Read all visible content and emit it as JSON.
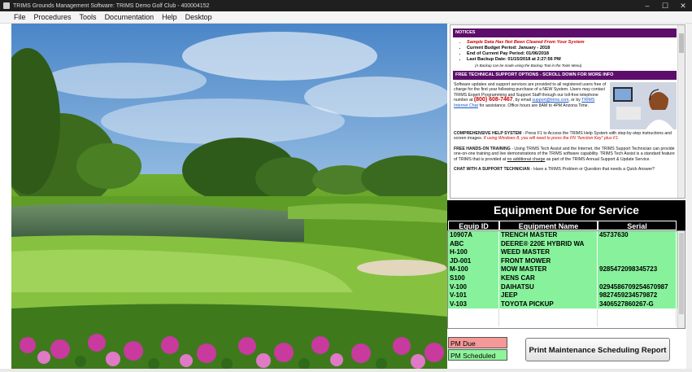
{
  "window": {
    "title": "TRIMS Grounds Management Software: TRIMS Demo Golf Club - 400004152",
    "minimize": "–",
    "maximize": "☐",
    "close": "✕"
  },
  "menu": [
    "File",
    "Procedures",
    "Tools",
    "Documentation",
    "Help",
    "Desktop"
  ],
  "notices": {
    "header": "NOTICES",
    "items": [
      "Sample Data Has Not Been Cleared From Your System",
      "Current Budget Period: January - 2018",
      "End of Current Pay Period: 01/06/2018",
      "Last Backup Date: 01/15/2018 at 2:27:56 PM"
    ],
    "backup_note": "(A Backup can be made using the Backup Tool in the Tools Menu)",
    "support_header": "FREE TECHNICAL SUPPORT OPTIONS - SCROLL DOWN FOR MORE INFO",
    "support_text_1": "Software updates and support services are provided to all registered users free of charge for the first year following purchase of a NEW System. Users may contact TRIMS Expert Programming and Support Staff through our toll-free telephone number at",
    "support_phone": "(800) 608-7467",
    "support_text_2": ", by email",
    "support_email": "support@trims.com",
    "support_text_3": ", or by",
    "support_chat_link": "TRIMS Internet Chat",
    "support_text_4": "for assistance. Office hours are 8AM to 4PM Arizona Time.",
    "help_title": "COMPREHENSIVE HELP SYSTEM",
    "help_text": "- Press F1 to Access the TRIMS Help System with step-by-step instructions and screen images.",
    "help_italic": "If using Windows 8, you will need to press the FN \"function Key\" plus F1.",
    "training_title": "FREE HANDS-ON TRAINING",
    "training_text": "- Using TRIMS Tech Assist and the Internet, the TRIMS Support Technician can provide one-on-one training and live demonstrations of the TRIMS software capability. TRIMS Tech Assist is a standard feature of TRIMS that is provided at",
    "training_link": "no additional charge",
    "training_text_2": "as part of the TRIMS Annual Support & Update Service.",
    "chat_title": "CHAT WITH A SUPPORT TECHNICIAN",
    "chat_text": "- Have a TRIMS Problem or Question that needs a Quick Answer?"
  },
  "equipment": {
    "title": "Equipment Due for Service",
    "columns": [
      "Equip ID",
      "Equipment Name",
      "Serial"
    ],
    "rows": [
      [
        "10907A",
        "TRENCH MASTER",
        "45737630"
      ],
      [
        "ABC",
        "DEERE® 220E HYBRID WA",
        ""
      ],
      [
        "H-100",
        "WEED MASTER",
        ""
      ],
      [
        "JD-001",
        "FRONT MOWER",
        ""
      ],
      [
        "M-100",
        "MOW MASTER",
        "9285472098345723"
      ],
      [
        "S100",
        "KENS CAR",
        ""
      ],
      [
        "V-100",
        "DAIHATSU",
        "0294586709254670987"
      ],
      [
        "V-101",
        "JEEP",
        "9827459234579872"
      ],
      [
        "V-103",
        "TOYOTA PICKUP",
        "3406527860267-G"
      ]
    ]
  },
  "legend": {
    "pm_due": "PM Due",
    "pm_scheduled": "PM Scheduled",
    "pm_due_color": "#f59898",
    "pm_scheduled_color": "#8ef59a"
  },
  "print_button": "Print Maintenance Scheduling Report"
}
